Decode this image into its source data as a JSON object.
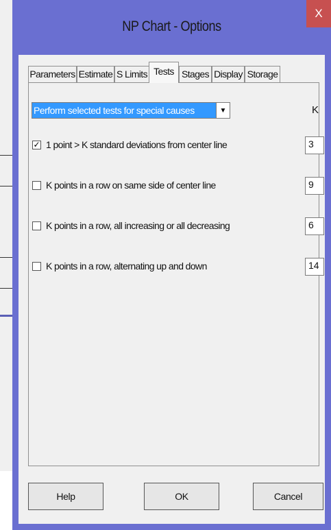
{
  "dialog": {
    "title": "NP Chart - Options",
    "close_label": "X"
  },
  "tabs": [
    {
      "label": "Parameters",
      "active": false
    },
    {
      "label": "Estimate",
      "active": false
    },
    {
      "label": "S Limits",
      "active": false
    },
    {
      "label": "Tests",
      "active": true
    },
    {
      "label": "Stages",
      "active": false
    },
    {
      "label": "Display",
      "active": false
    },
    {
      "label": "Storage",
      "active": false
    }
  ],
  "tests_panel": {
    "dropdown_value": "Perform selected tests for special causes",
    "k_header": "K",
    "tests": [
      {
        "label": "1 point > K standard deviations from center line",
        "checked": true,
        "k": "3"
      },
      {
        "label": "K points in a row on same side of center line",
        "checked": false,
        "k": "9"
      },
      {
        "label": "K points in a row, all increasing or all decreasing",
        "checked": false,
        "k": "6"
      },
      {
        "label": "K points in a row, alternating up and down",
        "checked": false,
        "k": "14"
      }
    ]
  },
  "buttons": {
    "help": "Help",
    "ok": "OK",
    "cancel": "Cancel"
  },
  "colors": {
    "frame": "#6a6fd1",
    "close": "#c75050",
    "selection": "#3399ff"
  }
}
